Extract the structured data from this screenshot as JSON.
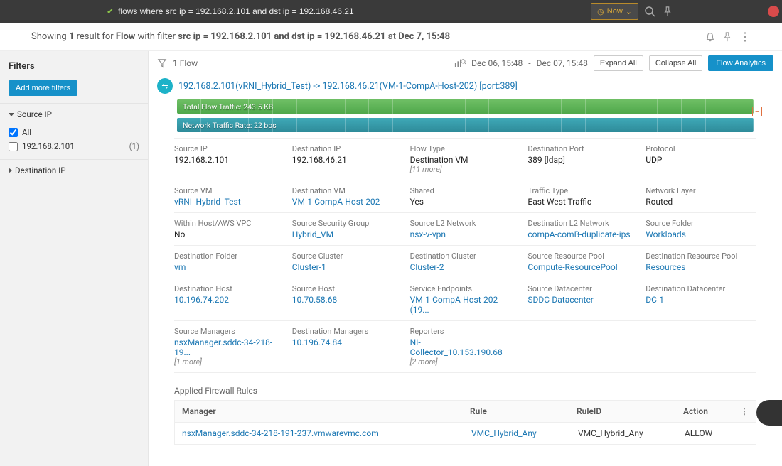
{
  "topbar": {
    "query": "flows where src ip = 192.168.2.101 and dst ip = 192.168.46.21",
    "now_label": "Now"
  },
  "summary": {
    "prefix": "Showing ",
    "count": "1",
    "mid1": " result for ",
    "entity": "Flow",
    "mid2": " with filter ",
    "filter": "src ip = 192.168.2.101 and dst ip = 192.168.46.21",
    "mid3": " at ",
    "time": "Dec 7, 15:48"
  },
  "sidebar": {
    "title": "Filters",
    "add_more": "Add more filters",
    "facets": {
      "src_ip": {
        "title": "Source IP",
        "all_label": "All",
        "item1_label": "192.168.2.101",
        "item1_count": "(1)"
      },
      "dst_ip": {
        "title": "Destination IP"
      }
    }
  },
  "toolbar": {
    "flow_count": "1 Flow",
    "time_start": "Dec 06, 15:48",
    "time_end": "Dec 07, 15:48",
    "expand_all": "Expand All",
    "collapse_all": "Collapse All",
    "flow_analytics": "Flow Analytics"
  },
  "flow": {
    "title": "192.168.2.101(vRNI_Hybrid_Test) -> 192.168.46.21(VM-1-CompA-Host-202) [port:389]",
    "bar1": "Total Flow Traffic: 243.5 KB",
    "bar2": "Network Traffic Rate: 22 bps"
  },
  "details": {
    "r1": {
      "c1": {
        "lbl": "Source IP",
        "val": "192.168.2.101",
        "link": false
      },
      "c2": {
        "lbl": "Destination IP",
        "val": "192.168.46.21",
        "link": false
      },
      "c3": {
        "lbl": "Flow Type",
        "val": "Destination VM",
        "more": "[11 more]"
      },
      "c4": {
        "lbl": "Destination Port",
        "val": "389 [ldap]",
        "link": false
      },
      "c5": {
        "lbl": "Protocol",
        "val": "UDP",
        "link": false
      }
    },
    "r2": {
      "c1": {
        "lbl": "Source VM",
        "val": "vRNI_Hybrid_Test",
        "link": true
      },
      "c2": {
        "lbl": "Destination VM",
        "val": "VM-1-CompA-Host-202",
        "link": true
      },
      "c3": {
        "lbl": "Shared",
        "val": "Yes"
      },
      "c4": {
        "lbl": "Traffic Type",
        "val": "East West Traffic"
      },
      "c5": {
        "lbl": "Network Layer",
        "val": "Routed"
      }
    },
    "r3": {
      "c1": {
        "lbl": "Within Host/AWS VPC",
        "val": "No"
      },
      "c2": {
        "lbl": "Source Security Group",
        "val": "Hybrid_VM",
        "link": true
      },
      "c3": {
        "lbl": "Source L2 Network",
        "val": "nsx-v-vpn",
        "link": true
      },
      "c4": {
        "lbl": "Destination L2 Network",
        "val": "compA-comB-duplicate-ips",
        "link": true
      },
      "c5": {
        "lbl": "Source Folder",
        "val": "Workloads",
        "link": true
      }
    },
    "r4": {
      "c1": {
        "lbl": "Destination Folder",
        "val": "vm",
        "link": true
      },
      "c2": {
        "lbl": "Source Cluster",
        "val": "Cluster-1",
        "link": true
      },
      "c3": {
        "lbl": "Destination Cluster",
        "val": "Cluster-2",
        "link": true
      },
      "c4": {
        "lbl": "Source Resource Pool",
        "val": "Compute-ResourcePool",
        "link": true
      },
      "c5": {
        "lbl": "Destination Resource Pool",
        "val": "Resources",
        "link": true
      }
    },
    "r5": {
      "c1": {
        "lbl": "Destination Host",
        "val": "10.196.74.202",
        "link": true
      },
      "c2": {
        "lbl": "Source Host",
        "val": "10.70.58.68",
        "link": true
      },
      "c3": {
        "lbl": "Service Endpoints",
        "val": "VM-1-CompA-Host-202 (19...",
        "link": true
      },
      "c4": {
        "lbl": "Source Datacenter",
        "val": "SDDC-Datacenter",
        "link": true
      },
      "c5": {
        "lbl": "Destination Datacenter",
        "val": "DC-1",
        "link": true
      }
    },
    "r6": {
      "c1": {
        "lbl": "Source Managers",
        "val": "nsxManager.sddc-34-218-19...",
        "link": true,
        "more": "[1 more]"
      },
      "c2": {
        "lbl": "Destination Managers",
        "val": "10.196.74.84",
        "link": true
      },
      "c3": {
        "lbl": "Reporters",
        "val": "NI-Collector_10.153.190.68",
        "link": true,
        "more": "[2 more]"
      },
      "c4": null,
      "c5": null
    }
  },
  "rules": {
    "title": "Applied Firewall Rules",
    "head": {
      "manager": "Manager",
      "rule": "Rule",
      "ruleid": "RuleID",
      "action": "Action"
    },
    "row1": {
      "manager": "nsxManager.sddc-34-218-191-237.vmwarevmc.com",
      "rule": "VMC_Hybrid_Any",
      "ruleid": "VMC_Hybrid_Any",
      "action": "ALLOW"
    }
  }
}
